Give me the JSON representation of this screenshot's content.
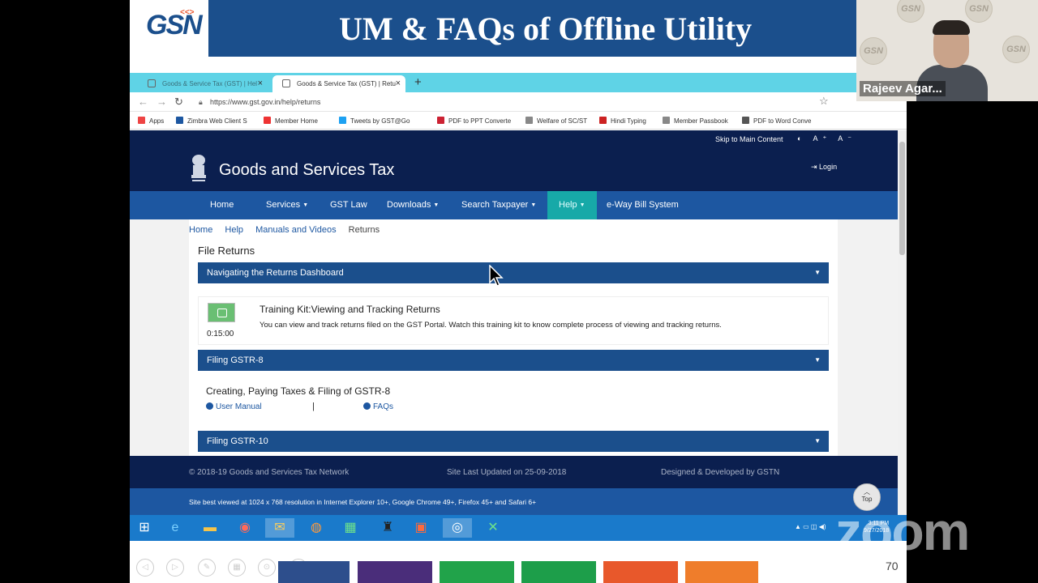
{
  "slide": {
    "title": "UM & FAQs of Offline Utility",
    "logo_text": "GSN",
    "logo_mark": "<<>",
    "slide_number": "70"
  },
  "browser": {
    "tabs": [
      {
        "label": "Goods & Service Tax (GST) | Hel",
        "close": "×"
      },
      {
        "label": "Goods & Service Tax (GST) | Retu",
        "close": "×"
      }
    ],
    "new_tab": "+",
    "url": "https://www.gst.gov.in/help/returns",
    "bookmarks": [
      {
        "label": "Apps",
        "color": "#e44"
      },
      {
        "label": "Zimbra Web Client S",
        "color": "#1d57a1"
      },
      {
        "label": "Member Home",
        "color": "#e33"
      },
      {
        "label": "Tweets by GST@Go",
        "color": "#1da1f2"
      },
      {
        "label": "PDF to PPT Converte",
        "color": "#c23"
      },
      {
        "label": "Welfare of SC/ST",
        "color": "#888"
      },
      {
        "label": "Hindi Typing",
        "color": "#c22"
      },
      {
        "label": "Member Passbook",
        "color": "#888"
      },
      {
        "label": "PDF to Word Conve",
        "color": "#555"
      }
    ]
  },
  "site": {
    "skip_link": "Skip to Main Content",
    "a11y_controls": "◐ A⁺ A⁻",
    "name": "Goods and Services Tax",
    "login": "Login",
    "nav": [
      {
        "label": "Home",
        "caret": ""
      },
      {
        "label": "Services",
        "caret": "▼"
      },
      {
        "label": "GST Law",
        "caret": ""
      },
      {
        "label": "Downloads",
        "caret": "▼"
      },
      {
        "label": "Search Taxpayer",
        "caret": "▼"
      },
      {
        "label": "Help",
        "caret": "▼"
      },
      {
        "label": "e-Way Bill System",
        "caret": ""
      }
    ],
    "breadcrumbs": [
      "Home",
      "Help",
      "Manuals and Videos",
      "Returns"
    ],
    "section_title": "File Returns",
    "accordions": [
      {
        "label": "Navigating the Returns Dashboard"
      },
      {
        "label": "Filing GSTR-8"
      },
      {
        "label": "Filing GSTR-10"
      }
    ],
    "training_kit": {
      "title": "Training Kit:Viewing and Tracking Returns",
      "description": "You can view and track returns filed on the GST Portal. Watch this training kit to know complete process of viewing and tracking returns.",
      "duration": "0:15:00"
    },
    "gstr8": {
      "title": "Creating, Paying Taxes & Filing of GSTR-8",
      "user_manual": "User Manual",
      "separator": "|",
      "faqs": "FAQs"
    },
    "footer": {
      "copyright": "© 2018-19 Goods and Services Tax Network",
      "updated": "Site Last Updated on 25-09-2018",
      "developed": "Designed & Developed by GSTN",
      "best_viewed": "Site best viewed at 1024 x 768 resolution in Internet Explorer 10+, Google Chrome 49+, Firefox 45+ and Safari 6+",
      "top": "Top"
    }
  },
  "taskbar": {
    "clock_time": "3:11 PM",
    "clock_date": "9/27/2018"
  },
  "video": {
    "participant_name": "Rajeev Agar...",
    "badge": "GSN"
  },
  "watermark": "zoom"
}
